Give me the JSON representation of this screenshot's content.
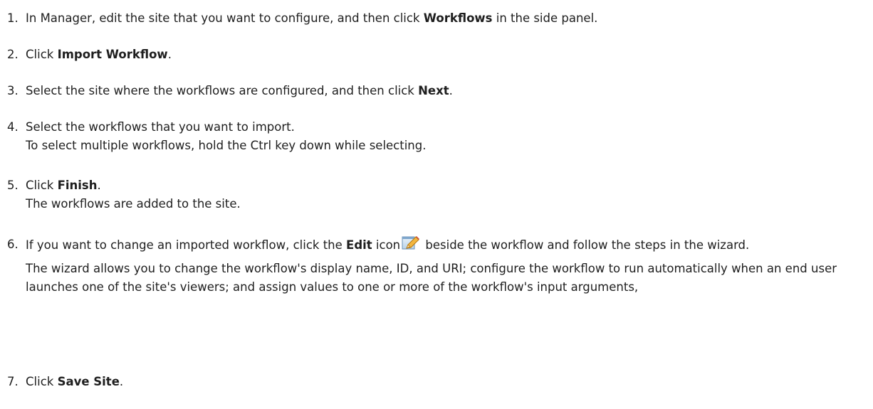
{
  "steps": [
    {
      "num": "1.",
      "a": "In Manager, edit the site that you want to configure, and then click ",
      "b": "Workflows",
      "c": " in the side panel."
    },
    {
      "num": "2.",
      "a": "Click ",
      "b": "Import Workflow",
      "c": "."
    },
    {
      "num": "3.",
      "a": "Select the site where the workflows are configured, and then click ",
      "b": "Next",
      "c": "."
    },
    {
      "num": "4.",
      "a": "Select the workflows that you want to import.",
      "note": "To select multiple workflows, hold the Ctrl key down while selecting."
    },
    {
      "num": "5.",
      "a": "Click ",
      "b": "Finish",
      "c": ".",
      "note": "The workflows are added to the site."
    },
    {
      "num": "6.",
      "a": "If you want to change an imported workflow, click the ",
      "b": "Edit",
      "c": " icon",
      "d": " beside the workflow and follow the steps in the wizard.",
      "icon": "edit-pencil-icon",
      "note": "The wizard allows you to change the workflow's display name, ID, and URI; configure the workflow to run automatically when an end user launches one of the site's viewers; and assign values to one or more of the workflow's input arguments,"
    },
    {
      "num": "7.",
      "a": "Click ",
      "b": "Save Site",
      "c": "."
    }
  ]
}
